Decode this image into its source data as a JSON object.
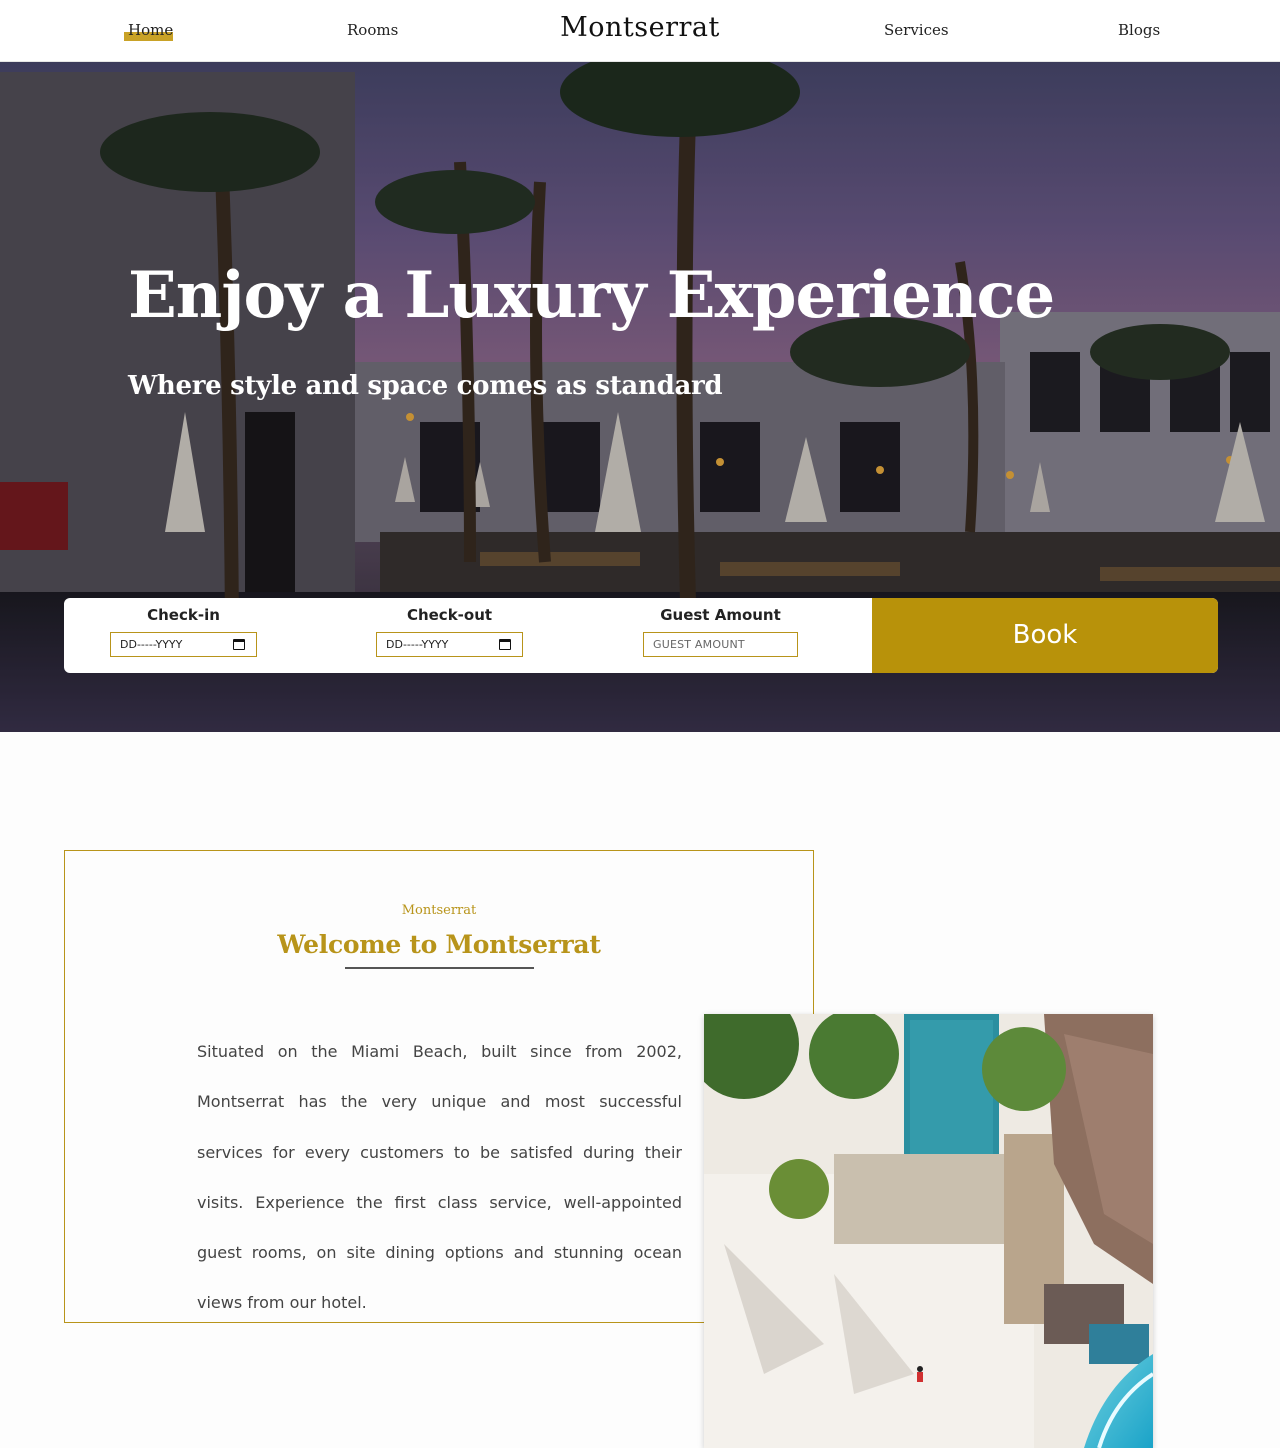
{
  "nav": {
    "home": "Home",
    "rooms": "Rooms",
    "brand": "Montserrat",
    "services": "Services",
    "blogs": "Blogs"
  },
  "hero": {
    "title": "Enjoy a Luxury Experience",
    "subtitle": "Where style and space comes as standard"
  },
  "booking": {
    "checkin_label": "Check-in",
    "checkin_value": "DD-----YYYY",
    "checkout_label": "Check-out",
    "checkout_value": "DD-----YYYY",
    "guest_label": "Guest Amount",
    "guest_placeholder": "GUEST AMOUNT",
    "book_label": "Book"
  },
  "welcome": {
    "eyebrow": "Montserrat",
    "title": "Welcome to Montserrat",
    "body": "Situated on the Miami Beach, built since from 2002, Montserrat has the very unique and most successful services for every customers to be satisfed during their visits. Experience the first class service, well-appointed guest rooms, on site dining options and stunning ocean views from our hotel."
  },
  "colors": {
    "accent": "#b8920a",
    "accent_border": "#b8941a",
    "nav_highlight": "#c9a227"
  },
  "icons": {
    "date_picker": "calendar-icon"
  }
}
